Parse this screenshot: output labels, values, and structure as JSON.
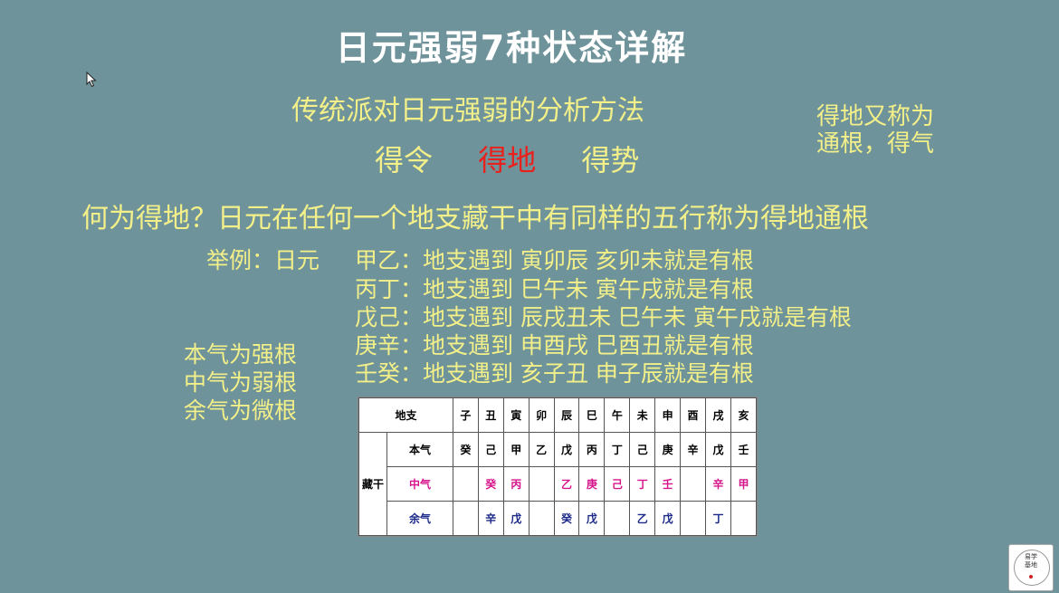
{
  "title": "日元强弱7种状态详解",
  "subtitle": "传统派对日元强弱的分析方法",
  "terms": [
    "得令",
    "得地",
    "得势"
  ],
  "side_note": [
    "得地又称为",
    "通根，得气"
  ],
  "question": "何为得地？日元在任何一个地支藏干中有同样的五行称为得地通根",
  "example_label": "举例：日元",
  "example_rows": [
    "甲乙：地支遇到 寅卯辰 亥卯未就是有根",
    "丙丁：地支遇到 巳午未 寅午戌就是有根",
    "戊己：地支遇到 辰戌丑未  巳午未 寅午戌就是有根",
    "庚辛：地支遇到 申酉戌 巳酉丑就是有根",
    "壬癸：地支遇到 亥子丑 申子辰就是有根"
  ],
  "root_notes": [
    "本气为强根",
    "中气为弱根",
    "余气为微根"
  ],
  "table": {
    "header_label": "地支",
    "branches": [
      "子",
      "丑",
      "寅",
      "卯",
      "辰",
      "巳",
      "午",
      "未",
      "申",
      "酉",
      "戌",
      "亥"
    ],
    "group_label": "藏干",
    "rows": [
      {
        "label": "本气",
        "cells": [
          "癸",
          "己",
          "甲",
          "乙",
          "戊",
          "丙",
          "丁",
          "己",
          "庚",
          "辛",
          "戊",
          "壬"
        ]
      },
      {
        "label": "中气",
        "cells": [
          "",
          "癸",
          "丙",
          "",
          "乙",
          "庚",
          "己",
          "丁",
          "壬",
          "",
          "辛",
          "甲"
        ]
      },
      {
        "label": "余气",
        "cells": [
          "",
          "辛",
          "戊",
          "",
          "癸",
          "戊",
          "",
          "乙",
          "戊",
          "",
          "丁",
          ""
        ]
      }
    ]
  },
  "logo_text": [
    "易学",
    "基地"
  ],
  "colors": {
    "background": "#6f939a",
    "text_yellow": "#f3f08a",
    "highlight_red": "#e8211d",
    "pink": "#d6148c",
    "blue": "#1b2a8a"
  },
  "icons": {
    "cursor": "arrow-cursor-icon"
  }
}
